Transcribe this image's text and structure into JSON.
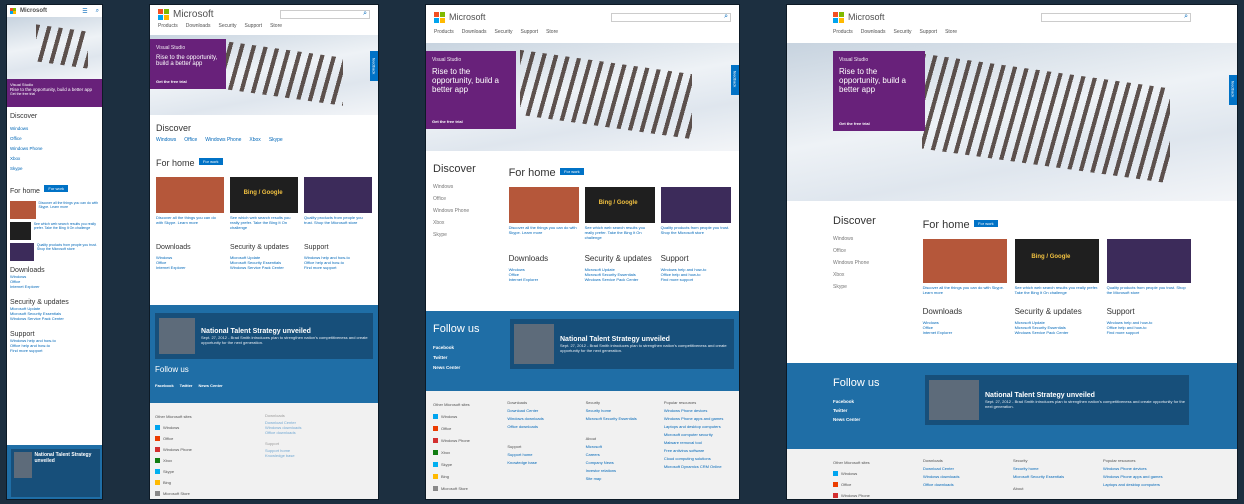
{
  "brand": "Microsoft",
  "nav": [
    "Products",
    "Downloads",
    "Security",
    "Support",
    "Store"
  ],
  "promo": {
    "vs": "Visual Studio",
    "headline": "Rise to the opportunity, build a better app",
    "cta": "Get the free trial"
  },
  "feedback": "feedback",
  "discover": {
    "title": "Discover",
    "items": [
      "Windows",
      "Office",
      "Windows Phone",
      "Xbox",
      "Skype"
    ]
  },
  "forhome": {
    "title": "For home",
    "pill": "For work",
    "tiles": [
      {
        "text": "Discover all the things you can do with Skype. Learn more"
      },
      {
        "text": "See which web search results you really prefer. Take the Bing It On challenge",
        "brand": "Bing / Google"
      },
      {
        "text": "Quality products from people you trust. Shop the Microsoft store"
      }
    ]
  },
  "downloads": {
    "title": "Downloads",
    "items": [
      "Windows",
      "Office",
      "Internet Explorer"
    ]
  },
  "security": {
    "title": "Security & updates",
    "items": [
      "Microsoft Update",
      "Microsoft Security Essentials",
      "Windows Service Pack Center"
    ]
  },
  "support": {
    "title": "Support",
    "items": [
      "Windows help and how-to",
      "Office help and how-to",
      "Find more support"
    ]
  },
  "follow": {
    "title": "Follow us",
    "items": [
      "Facebook",
      "Twitter",
      "News Center"
    ]
  },
  "news": {
    "title": "National Talent Strategy unveiled",
    "date": "Sept. 27, 2012 - Brad Smith introduces plan to strengthen nation's competitiveness and create opportunity for the next generation."
  },
  "footer": {
    "other_title": "Other Microsoft sites",
    "other_items": [
      "Windows",
      "Office",
      "Windows Phone",
      "Xbox",
      "Skype",
      "Bing",
      "Microsoft Store"
    ],
    "downloads_title": "Downloads",
    "downloads_items": [
      "Download Center",
      "Windows downloads",
      "Office downloads"
    ],
    "security_title": "Security",
    "security_items": [
      "Security home",
      "Microsoft Security Essentials"
    ],
    "popular_title": "Popular resources",
    "popular_items": [
      "Windows Phone devices",
      "Windows Phone apps and games",
      "Laptops and desktop computers",
      "Microsoft computer security",
      "Malware removal tool",
      "Free antivirus software",
      "Cloud computing solutions",
      "Microsoft Dynamics CRM Online"
    ],
    "support_title": "Support",
    "support_items": [
      "Support home",
      "Knowledge base"
    ],
    "about_title": "About",
    "about_items": [
      "Microsoft",
      "Careers",
      "Company News",
      "Investor relations",
      "Site map"
    ]
  },
  "colors": {
    "purple": "#68217a",
    "blue": "#1f6ea6",
    "link": "#0067b8"
  }
}
